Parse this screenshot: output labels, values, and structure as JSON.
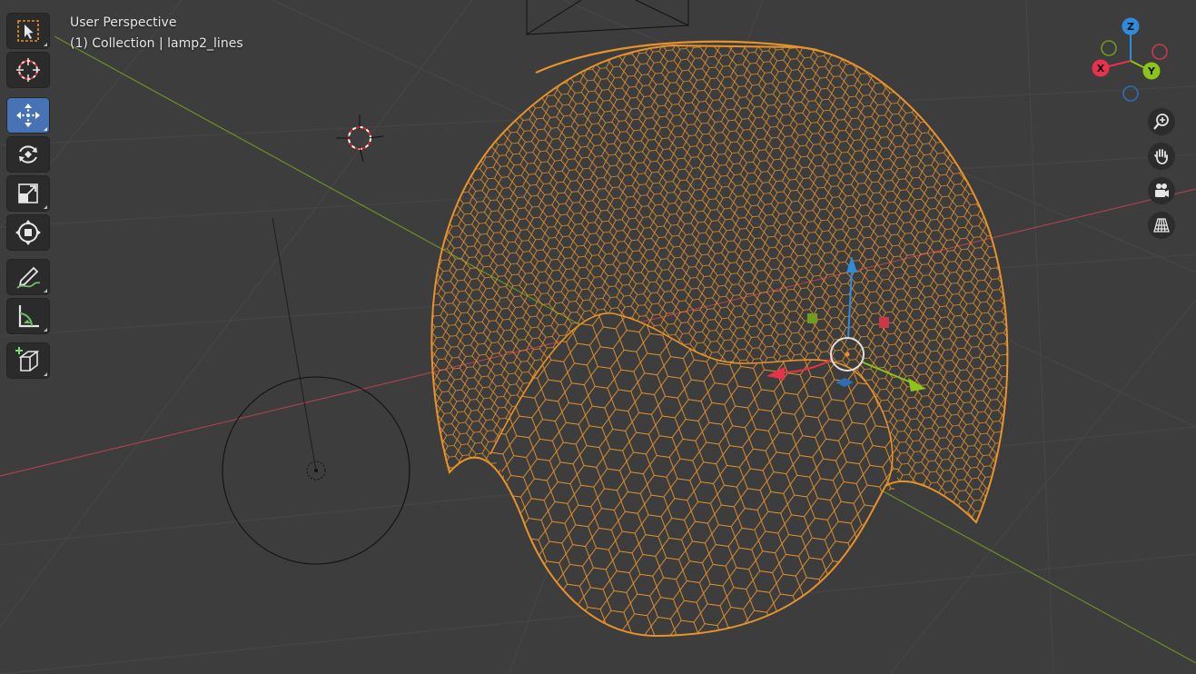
{
  "viewport": {
    "view_name": "User Perspective",
    "collection_line": "(1) Collection | lamp2_lines"
  },
  "toolbar": {
    "tools": [
      {
        "name": "select-box",
        "active": false
      },
      {
        "name": "cursor",
        "active": false
      },
      {
        "name": "move",
        "active": true
      },
      {
        "name": "rotate",
        "active": false
      },
      {
        "name": "scale",
        "active": false
      },
      {
        "name": "transform",
        "active": false
      },
      {
        "name": "annotate",
        "active": false
      },
      {
        "name": "measure",
        "active": false
      },
      {
        "name": "add-cube",
        "active": false
      }
    ]
  },
  "navigation_gizmo": {
    "axes": [
      {
        "label": "Z",
        "color": "#2f8bdc"
      },
      {
        "label": "X",
        "color": "#e8304f"
      },
      {
        "label": "Y",
        "color": "#8cc41a"
      }
    ],
    "buttons": [
      "zoom-icon",
      "hand-pan-icon",
      "camera-icon",
      "perspective-grid-icon"
    ]
  },
  "colors": {
    "background": "#3d3d3d",
    "grid": "#4a4a4a",
    "x_axis_line": "#a8414f",
    "y_axis_line": "#6a9126",
    "wireframe": "#e8922a",
    "active_tool": "#4772b3"
  }
}
